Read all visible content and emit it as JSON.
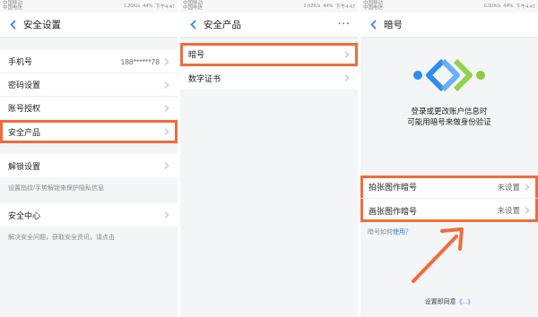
{
  "status": {
    "s1": {
      "carrier1": "中国移动",
      "carrier2": "中国电信",
      "speed": "1.26K/s",
      "battery": "44%",
      "time": "下午4:47"
    },
    "s2": {
      "carrier1": "中国移动",
      "carrier2": "中国电信",
      "speed": "2.02K/s",
      "battery": "44%",
      "time": "下午4:47"
    },
    "s3": {
      "carrier1": "中国移动",
      "carrier2": "中国电信",
      "speed": "0.00K/s",
      "battery": "44%",
      "time": "下午4:47"
    }
  },
  "screen1": {
    "title": "安全设置",
    "phone_label": "手机号",
    "phone_value": "188******78",
    "password_label": "密码设置",
    "account_auth_label": "账号授权",
    "security_products_label": "安全产品",
    "unlock_label": "解锁设置",
    "unlock_hint": "设置指纹/手势解锁来保护隐私信息",
    "security_center_label": "安全中心",
    "security_center_hint": "解决安全问题，获取安全资讯，请点击"
  },
  "screen2": {
    "title": "安全产品",
    "more": "···",
    "secret_code_label": "暗号",
    "digital_cert_label": "数字证书"
  },
  "screen3": {
    "title": "暗号",
    "desc_line1": "登录或更改账户信息时",
    "desc_line2": "可能用暗号来做身份验证",
    "photo_code_label": "拍张图作暗号",
    "photo_code_value": "未设置",
    "draw_code_label": "画张图作暗号",
    "draw_code_value": "未设置",
    "how_prefix": "暗号如何",
    "how_link": "使用？",
    "footer_prefix": "设置即同意",
    "footer_link": "《...》"
  },
  "colors": {
    "accent": "#2d7ff0",
    "highlight": "#f26b3a",
    "logo_blue": "#2d8cf0",
    "logo_green": "#8ccc3c"
  }
}
